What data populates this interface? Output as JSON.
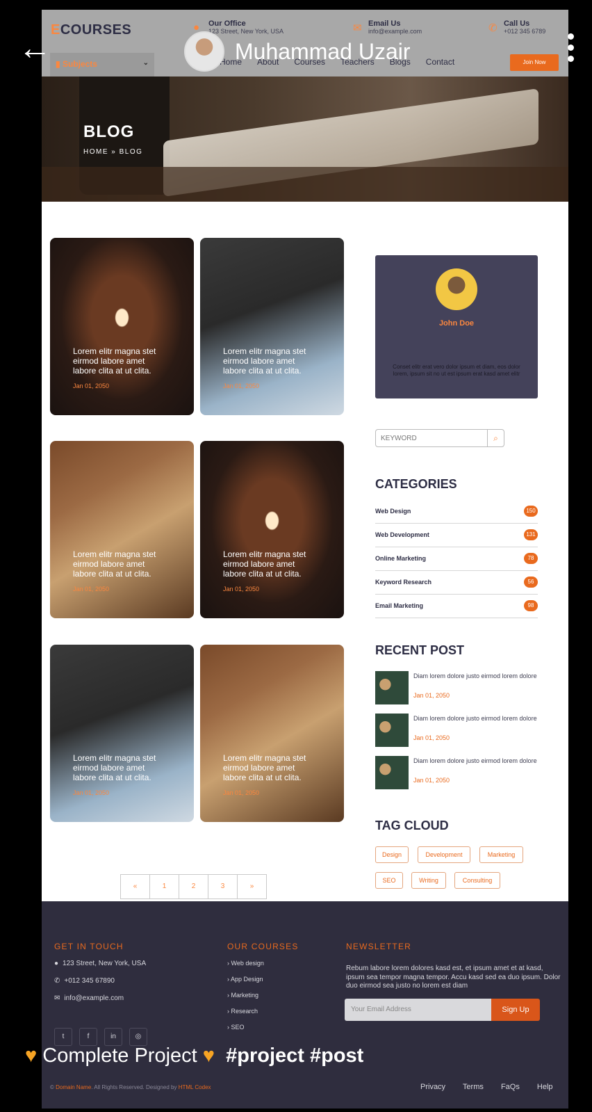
{
  "header": {
    "logo_first": "E",
    "logo_rest": "COURSES",
    "office_title": "Our Office",
    "office_value": "123 Street, New York, USA",
    "email_title": "Email Us",
    "email_value": "info@example.com",
    "call_title": "Call Us",
    "call_value": "+012 345 6789",
    "subjects_label": "Subjects",
    "nav": [
      "Home",
      "About",
      "Courses",
      "Teachers",
      "Blogs",
      "Contact"
    ],
    "join_label": "Join Now"
  },
  "overlay": {
    "username": "Muhammad Uzair",
    "caption_left": "Complete Project",
    "caption_tags": "#project #post"
  },
  "hero": {
    "title": "BLOG",
    "crumb_home": "HOME",
    "crumb_sep": "»",
    "crumb_current": "BLOG"
  },
  "posts": [
    {
      "text": "Lorem elitr magna stet eirmod labore amet labore clita at ut clita.",
      "date": "Jan 01, 2050",
      "image": "library"
    },
    {
      "text": "Lorem elitr magna stet eirmod labore amet labore clita at ut clita.",
      "date": "Jan 01, 2050",
      "image": "student-laptop"
    },
    {
      "text": "Lorem elitr magna stet eirmod labore amet labore clita at ut clita.",
      "date": "Jan 01, 2050",
      "image": "girl-reading"
    },
    {
      "text": "Lorem elitr magna stet eirmod labore amet labore clita at ut clita.",
      "date": "Jan 01, 2050",
      "image": "library"
    },
    {
      "text": "Lorem elitr magna stet eirmod labore amet labore clita at ut clita.",
      "date": "Jan 01, 2050",
      "image": "student-laptop"
    },
    {
      "text": "Lorem elitr magna stet eirmod labore amet labore clita at ut clita.",
      "date": "Jan 01, 2050",
      "image": "girl-reading"
    }
  ],
  "pager": [
    "«",
    "1",
    "2",
    "3",
    "»"
  ],
  "profile": {
    "name": "John Doe",
    "bio": "Conset elitr erat vero dolor ipsum et diam, eos dolor lorem, ipsum sit no ut est ipsum erat kasd amet elitr"
  },
  "search": {
    "placeholder": "KEYWORD"
  },
  "categories": {
    "heading": "CATEGORIES",
    "items": [
      {
        "label": "Web Design",
        "count": "150"
      },
      {
        "label": "Web Development",
        "count": "131"
      },
      {
        "label": "Online Marketing",
        "count": "78"
      },
      {
        "label": "Keyword Research",
        "count": "56"
      },
      {
        "label": "Email Marketing",
        "count": "98"
      }
    ]
  },
  "recent": {
    "heading": "RECENT POST",
    "items": [
      {
        "title": "Diam lorem dolore justo eirmod lorem dolore",
        "date": "Jan 01, 2050"
      },
      {
        "title": "Diam lorem dolore justo eirmod lorem dolore",
        "date": "Jan 01, 2050"
      },
      {
        "title": "Diam lorem dolore justo eirmod lorem dolore",
        "date": "Jan 01, 2050"
      }
    ]
  },
  "tags": {
    "heading": "TAG CLOUD",
    "items": [
      "Design",
      "Development",
      "Marketing",
      "SEO",
      "Writing",
      "Consulting"
    ]
  },
  "footer": {
    "touch_heading": "GET IN TOUCH",
    "address": "123 Street, New York, USA",
    "phone": "+012 345 67890",
    "email": "info@example.com",
    "courses_heading": "OUR COURSES",
    "courses": [
      "Web design",
      "App Design",
      "Marketing",
      "Research",
      "SEO"
    ],
    "news_heading": "NEWSLETTER",
    "news_text": "Rebum labore lorem dolores kasd est, et ipsum amet et at kasd, ipsum sea tempor magna tempor. Accu kasd sed ea duo ipsum. Dolor duo eirmod sea justo no lorem est diam",
    "email_placeholder": "Your Email Address",
    "signup_label": "Sign Up",
    "copy_pre": "©",
    "copy_domain": "Domain Name",
    "copy_mid": ". All Rights Reserved. Designed by",
    "copy_designer": "HTML Codex",
    "links": [
      "Privacy",
      "Terms",
      "FaQs",
      "Help"
    ]
  },
  "colors": {
    "accent": "#e96a1e",
    "dark": "#2f2d3e",
    "profile_bg": "#44425a"
  }
}
